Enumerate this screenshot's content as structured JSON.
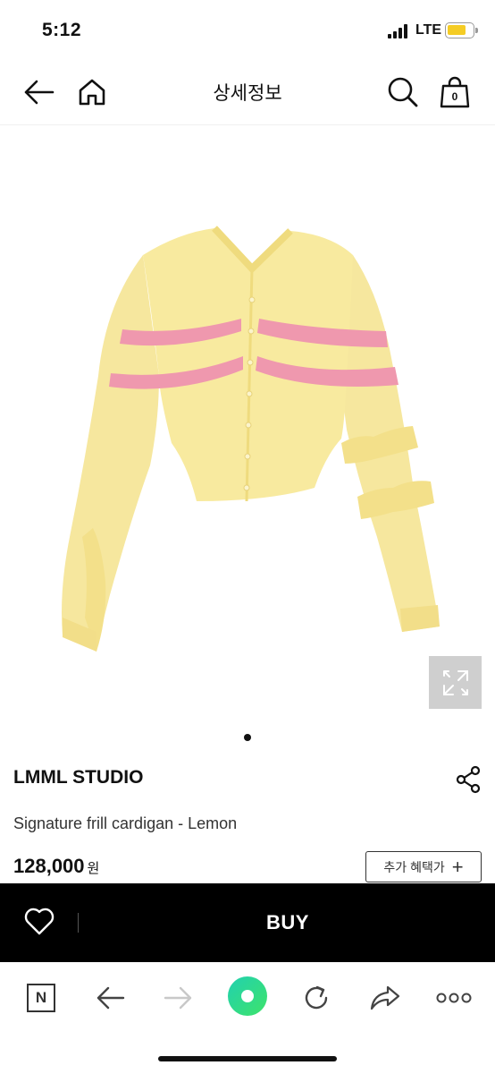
{
  "status_bar": {
    "time": "5:12",
    "network": "LTE",
    "battery_level": 0.75,
    "battery_color": "#f5cc24"
  },
  "header": {
    "title": "상세정보",
    "back_icon": "arrow-left-icon",
    "home_icon": "home-icon",
    "search_icon": "search-icon",
    "bag_icon": "shopping-bag-icon",
    "bag_count": "0"
  },
  "product": {
    "image_description_icon": "cardigan-image",
    "expand_icon": "expand-icon",
    "carousel_total": 1,
    "carousel_active": 1,
    "brand": "LMML STUDIO",
    "share_icon": "share-icon",
    "name": "Signature frill cardigan - Lemon",
    "price": "128,000",
    "price_unit": "원",
    "benefit_label": "추가 혜택가",
    "benefit_icon": "plus-icon"
  },
  "buy_bar": {
    "wish_icon": "heart-icon",
    "buy_label": "BUY",
    "background": "#000000"
  },
  "browser_toolbar": {
    "items": [
      {
        "icon": "naver-n-icon",
        "label": "N"
      },
      {
        "icon": "back-arrow-icon"
      },
      {
        "icon": "forward-arrow-icon"
      },
      {
        "icon": "green-dot-icon"
      },
      {
        "icon": "reload-icon"
      },
      {
        "icon": "share-forward-icon"
      },
      {
        "icon": "more-icon"
      }
    ],
    "accent": "#2ee08c"
  }
}
